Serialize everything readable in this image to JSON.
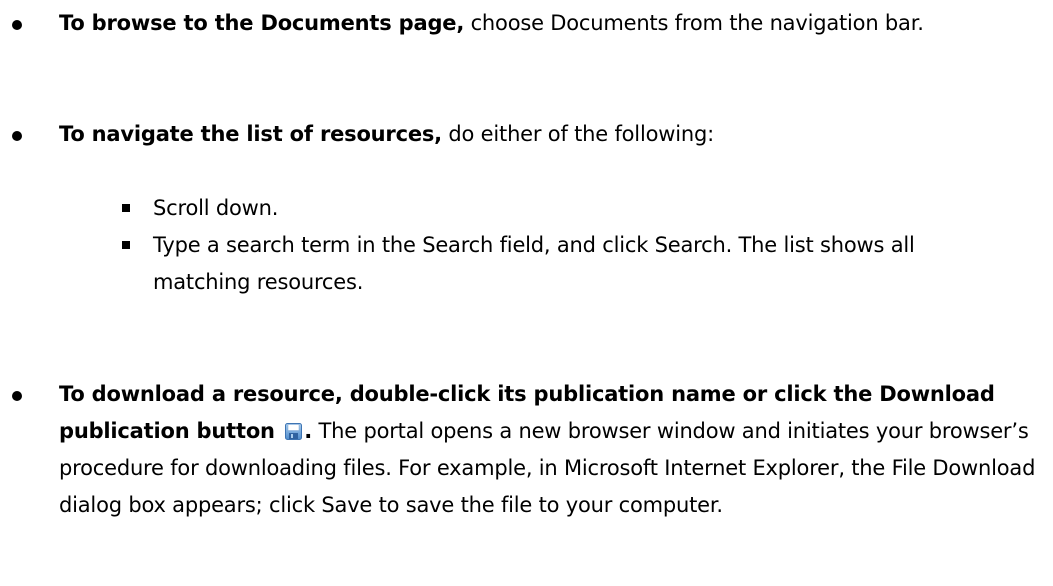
{
  "bullets": [
    {
      "bold": "To browse to the Documents page,",
      "text": " choose Documents from the navigation bar."
    },
    {
      "bold": "To navigate the list of resources,",
      "text": " do either of the following:",
      "sub_items": [
        "Scroll down.",
        "Type a search term in the Search field, and click Search. The list shows all matching resources."
      ]
    },
    {
      "bold_before_icon": "To download a resource, double-click its publication name or click the Download publication button",
      "icon": "save-icon",
      "bold_after_icon": ".",
      "text": " The portal opens a new browser window and initiates your browser’s procedure for downloading files. For example, in Microsoft Internet Explorer, the File Download dialog box appears; click Save to save the file to your computer."
    }
  ]
}
